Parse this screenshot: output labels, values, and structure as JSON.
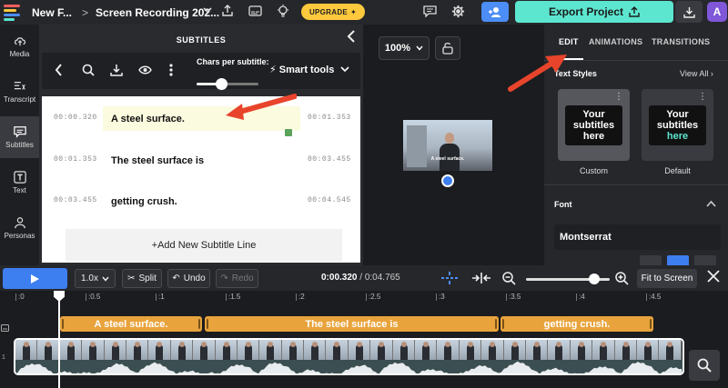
{
  "topbar": {
    "project_name": "New F...",
    "crumb_separator": ">",
    "recording_name": "Screen Recording 202...",
    "upgrade_label": "UPGRADE",
    "export_label": "Export Project",
    "avatar_initial": "A",
    "logo_colors": [
      "#f25f5c",
      "#ffc93d",
      "#4c8df6",
      "#5ce6d0"
    ]
  },
  "leftnav": {
    "items": [
      {
        "label": "Media",
        "icon": "cloud-upload-icon"
      },
      {
        "label": "Transcript",
        "icon": "transcript-icon"
      },
      {
        "label": "Subtitles",
        "icon": "subtitles-icon"
      },
      {
        "label": "Text",
        "icon": "text-icon"
      },
      {
        "label": "Personas",
        "icon": "person-icon"
      }
    ],
    "active": "Subtitles"
  },
  "subtitles_panel": {
    "title": "SUBTITLES",
    "chars_label": "Chars per subtitle:",
    "chars_level": 0.4,
    "smart_tools_label": "Smart tools",
    "rows": [
      {
        "start": "00:00.320",
        "text": "A steel surface.",
        "end": "00:01.353",
        "active": true
      },
      {
        "start": "00:01.353",
        "text": "The steel surface is",
        "end": "00:03.455",
        "active": false
      },
      {
        "start": "00:03.455",
        "text": "getting crush.",
        "end": "00:04.545",
        "active": false
      }
    ],
    "add_line_label": "+Add New Subtitle Line"
  },
  "preview": {
    "zoom_label": "100%",
    "caption": "A steel surface."
  },
  "right_panel": {
    "tabs": [
      "EDIT",
      "ANIMATIONS",
      "TRANSITIONS"
    ],
    "active_tab": "EDIT",
    "text_styles_label": "Text Styles",
    "view_all_label": "View All",
    "styles": [
      {
        "name": "Custom",
        "line1": "Your",
        "line2": "subtitles",
        "line3": "here",
        "accent": "#ffffff"
      },
      {
        "name": "Default",
        "line1": "Your",
        "line2": "subtitles",
        "line3": "here",
        "accent": "#5ce6d0"
      }
    ],
    "font_label": "Font",
    "font_value": "Montserrat"
  },
  "timeline_controls": {
    "speed_label": "1.0x",
    "split_label": "Split",
    "undo_label": "Undo",
    "redo_label": "Redo",
    "current_time": "0:00.320",
    "total_time": "/ 0:04.765",
    "zoom_level": 0.82,
    "fit_label": "Fit to Screen"
  },
  "timeline": {
    "ticks": [
      ":0",
      ":0.5",
      ":1",
      ":1.5",
      ":2",
      ":2.5",
      ":3",
      ":3.5",
      ":4",
      ":4.5"
    ],
    "subtitle_clips": [
      "A steel surface.",
      "The steel surface is",
      "getting crush."
    ],
    "track_labels": [
      "1"
    ],
    "accent_clip_color": "#e8a33c",
    "playhead_time": "0:00.320"
  }
}
